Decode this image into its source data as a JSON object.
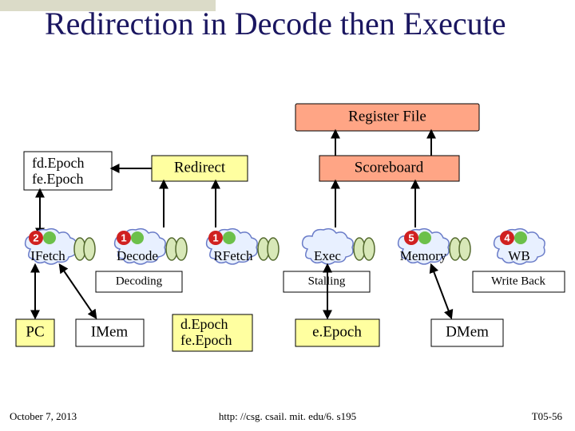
{
  "title": "Redirection in Decode then Execute",
  "blocks": {
    "registerFile": "Register File",
    "epochBox": {
      "line1": "fd.Epoch",
      "line2": "fe.Epoch"
    },
    "redirect": "Redirect",
    "scoreboard": "Scoreboard",
    "pc": "PC",
    "imem": "IMem",
    "dEpochBox": {
      "line1": "d.Epoch",
      "line2": "fe.Epoch"
    },
    "eEpoch": "e.Epoch",
    "dmem": "DMem"
  },
  "stages": {
    "ifetch": {
      "label": "IFetch",
      "badge": "2"
    },
    "decode": {
      "label": "Decode",
      "badge": "1"
    },
    "rfetch": {
      "label": "RFetch",
      "badge": "1"
    },
    "exec": {
      "label": "Exec",
      "badge": ""
    },
    "memory": {
      "label": "Memory",
      "badge": "5"
    },
    "wb": {
      "label": "WB",
      "badge": "4"
    }
  },
  "subs": {
    "decoding": "Decoding",
    "stalling": "Stalling",
    "writeback": "Write Back"
  },
  "footer": {
    "left": "October 7, 2013",
    "mid": "http: //csg. csail. mit. edu/6. s195",
    "right": "T05-56"
  }
}
